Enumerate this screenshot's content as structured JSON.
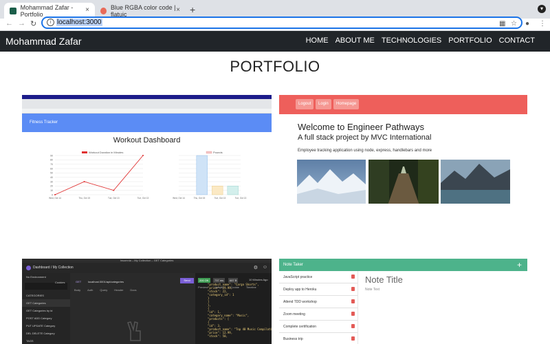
{
  "browser": {
    "tabs": [
      {
        "title": "Mohammad Zafar - Portfolio",
        "favicon_color": "#1b5e4a"
      },
      {
        "title": "Blue RGBA color code | flatuic",
        "favicon_color": "#e86b5a"
      }
    ],
    "new_tab_label": "+",
    "close_label": "×",
    "url": "localhost:3000"
  },
  "site": {
    "brand": "Mohammad Zafar",
    "nav": [
      "HOME",
      "ABOUT ME",
      "TECHNOLOGIES",
      "PORTFOLIO",
      "CONTACT"
    ],
    "heading": "PORTFOLIO"
  },
  "projects": {
    "fitness": {
      "banner": "Fitness Tracker",
      "dashboard_title": "Workout Dashboard",
      "line_legend": "Workout Duration in Minutes",
      "bar_legend": "Pounds",
      "x_ticks": [
        "Wed, Oct 14",
        "Thu, Oct 15",
        "Tue, Oct 13",
        "Tue, Oct 13"
      ],
      "y_ticks": [
        90,
        80,
        70,
        60,
        50,
        40,
        30,
        20,
        10,
        0
      ]
    },
    "pathways": {
      "buttons": [
        "Logout",
        "Login",
        "Homepage"
      ],
      "title": "Welcome to Engineer Pathways",
      "subtitle": "A full stack project by MVC International",
      "description": "Employee tracking application using node, express, handlebars and more"
    },
    "insomnia": {
      "window_title": "Insomnia – My Collection – GET Categories",
      "breadcrumb": "Dashboard / My Collection",
      "environment": "No Environment",
      "cookies": "Cookies",
      "method": "GET",
      "url": "localhost:3001/api/categories",
      "send": "Send",
      "status": "200 OK",
      "time": "737 ms",
      "size": "687 B",
      "ago": "10 Minutes Ago",
      "request_tabs": [
        "Body",
        "Auth",
        "Query",
        "Header",
        "Docs"
      ],
      "response_tabs": [
        "Preview",
        "Header",
        "Cookie",
        "Timeline"
      ],
      "sidebar": [
        "CATEGORIES",
        "GET  Categories",
        "GET  Categories by Id",
        "POST  ADD Category",
        "PUT  UPDATE Category",
        "DEL  DELETE Category",
        "TAGS"
      ],
      "code": "\"product_name\": \"Cargo Shorts\",\n\"price\": 29.99,\n\"stock\": 22,\n\"category_id\": 1\n}\n]\n},\n{\n\"id\": 1,\n\"category_name\": \"Music\",\n\"products\": [\n{\n\"id\": 3,\n\"product_name\": \"Top 40 Music Compilation Vinyl Record\",\n\"price\": 12.99,\n\"stock\": 50,"
    },
    "notes": {
      "app_title": "Note Taker",
      "add_label": "+",
      "items": [
        "JavaScript practice",
        "Deploy app to Heroku",
        "Attend TDD workshop",
        "Zoom meeting",
        "Complete certification",
        "Business trip"
      ],
      "note_title_placeholder": "Note Title",
      "note_text_placeholder": "Note Text"
    }
  },
  "chart_data": {
    "type": "line",
    "title": "Workout Dashboard",
    "series": [
      {
        "name": "Workout Duration in Minutes",
        "values": [
          0,
          30,
          10,
          90
        ]
      },
      {
        "name": "Pounds",
        "type": "bar",
        "values": [
          0,
          90,
          20,
          20
        ]
      }
    ],
    "ylim": [
      0,
      90
    ]
  }
}
